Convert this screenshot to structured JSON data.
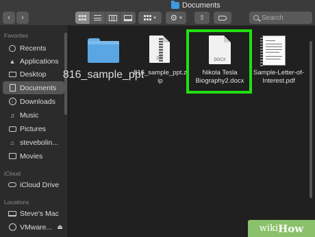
{
  "window": {
    "title": "Documents"
  },
  "toolbar": {
    "back_icon": "chevron-left-icon",
    "forward_icon": "chevron-right-icon",
    "view_modes": [
      "icon-view",
      "list-view",
      "column-view",
      "gallery-view"
    ],
    "active_view": "icon-view",
    "search_placeholder": "Search"
  },
  "sidebar": {
    "sections": [
      {
        "heading": "Favorites",
        "items": [
          {
            "label": "Recents",
            "icon": "clock-icon"
          },
          {
            "label": "Applications",
            "icon": "applications-icon"
          },
          {
            "label": "Desktop",
            "icon": "desktop-icon"
          },
          {
            "label": "Documents",
            "icon": "document-icon",
            "selected": true
          },
          {
            "label": "Downloads",
            "icon": "download-icon"
          },
          {
            "label": "Music",
            "icon": "music-icon"
          },
          {
            "label": "Pictures",
            "icon": "camera-icon"
          },
          {
            "label": "stevebolin...",
            "icon": "home-icon"
          },
          {
            "label": "Movies",
            "icon": "film-icon"
          }
        ]
      },
      {
        "heading": "iCloud",
        "items": [
          {
            "label": "iCloud Drive",
            "icon": "cloud-icon"
          }
        ]
      },
      {
        "heading": "Locations",
        "items": [
          {
            "label": "Steve's Mac",
            "icon": "laptop-icon"
          },
          {
            "label": "VMware...",
            "icon": "disk-icon"
          }
        ]
      }
    ]
  },
  "files": [
    {
      "name": "816_sample_ppt",
      "type": "folder"
    },
    {
      "name_line1": "816_sample_ppt.z",
      "name_line2": "ip",
      "type": "zip",
      "ext_label": "ZIP"
    },
    {
      "name_line1": "Nikola Tesla",
      "name_line2": "Biography2.docx",
      "type": "docx",
      "ext_label": "DOCX",
      "highlighted": true
    },
    {
      "name_line1": "Sample-Letter-of-",
      "name_line2": "Interest.pdf",
      "type": "pdf"
    }
  ],
  "colors": {
    "highlight": "#22e012",
    "folder": "#5aa6e3",
    "selection": "#575657",
    "watermark": "#8cc16b"
  },
  "watermark": {
    "text_a": "wiki",
    "text_b": "How"
  }
}
